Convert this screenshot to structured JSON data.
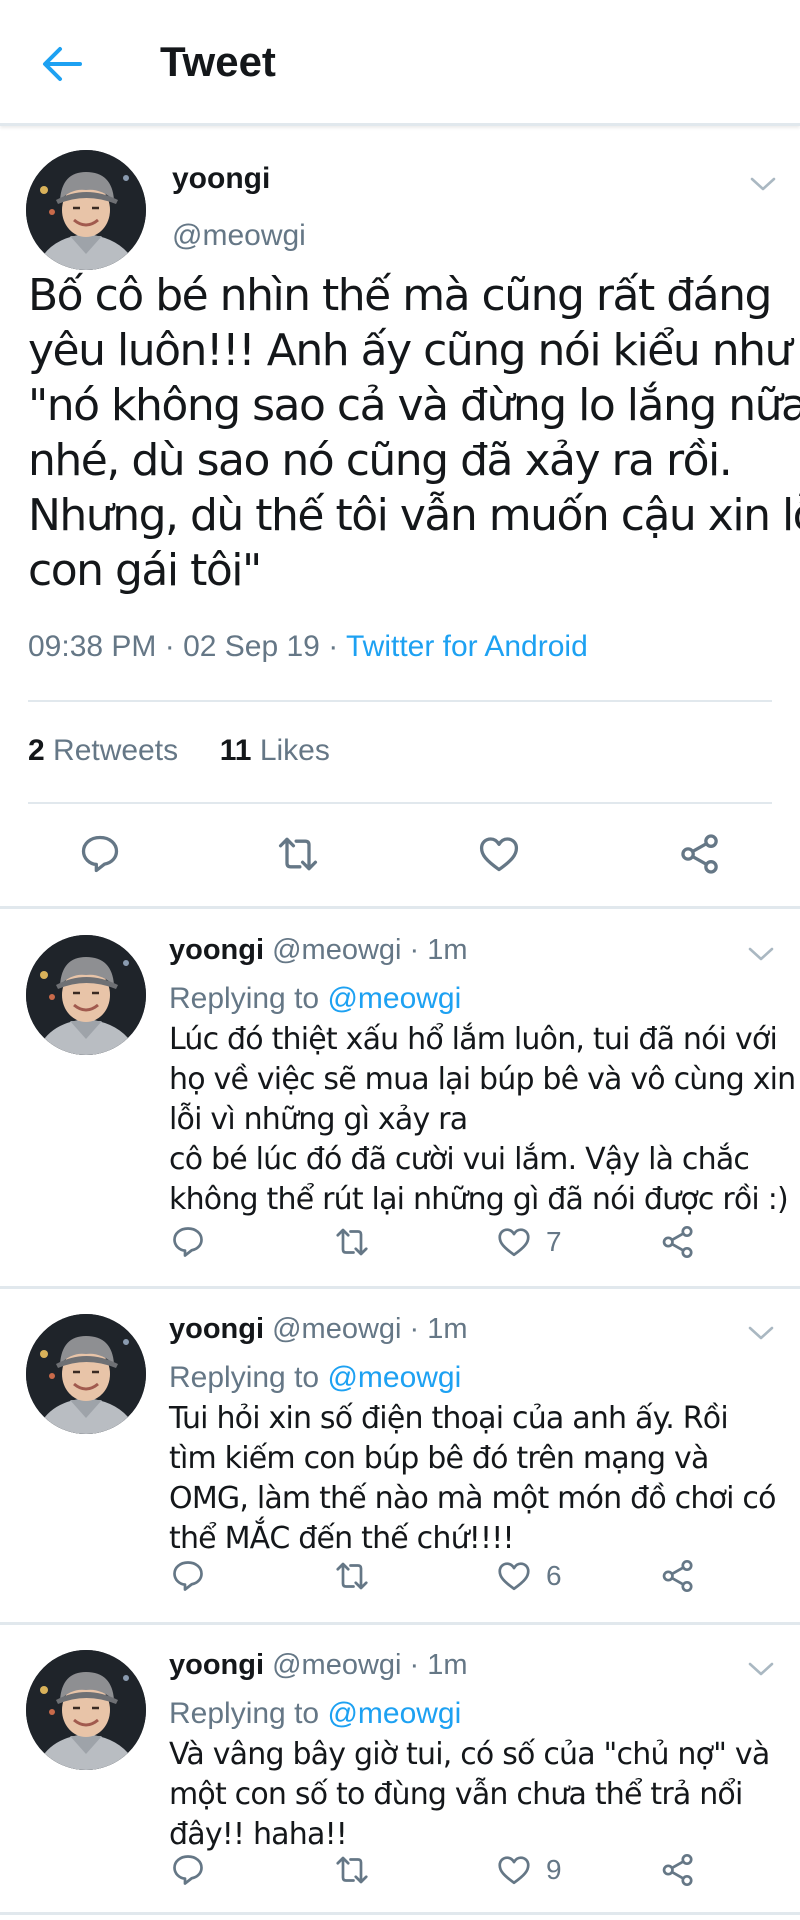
{
  "header": {
    "title": "Tweet"
  },
  "main_tweet": {
    "name": "yoongi",
    "handle": "@meowgi",
    "text_lines": [
      "Bố cô bé nhìn thế mà cũng rất đáng",
      "yêu luôn!!! Anh ấy cũng nói kiểu như",
      "\"nó không sao cả và đừng lo lắng nữa",
      "nhé, dù sao nó cũng đã xảy ra rồi.",
      "Nhưng, dù thế tôi vẫn muốn cậu xin lỗi",
      "con gái tôi\""
    ],
    "time": "09:38 PM · 02 Sep 19 · ",
    "source": "Twitter for Android",
    "retweets_count": "2",
    "retweets_label": " Retweets",
    "likes_count": "11",
    "likes_label": " Likes"
  },
  "replies": [
    {
      "name": "yoongi",
      "handle": "@meowgi · 1m",
      "replying_prefix": "Replying to ",
      "replying_to": "@meowgi",
      "text_lines": [
        "Lúc đó thiệt xấu hổ lắm luôn, tui đã nói với",
        "họ về việc sẽ mua lại búp bê và vô cùng xin",
        "lỗi vì những gì xảy ra",
        "cô bé lúc đó đã cười vui lắm. Vậy là chắc",
        "không thể rút lại những gì đã nói được rồi :)"
      ],
      "likes": "7"
    },
    {
      "name": "yoongi",
      "handle": "@meowgi · 1m",
      "replying_prefix": "Replying to ",
      "replying_to": "@meowgi",
      "text_lines": [
        "Tui hỏi xin số điện thoại của anh ấy. Rồi",
        "tìm kiếm con búp bê đó trên mạng và",
        "OMG, làm thế nào mà một món đồ chơi có",
        "thể MẮC đến thế chứ!!!!"
      ],
      "likes": "6"
    },
    {
      "name": "yoongi",
      "handle": "@meowgi · 1m",
      "replying_prefix": "Replying to ",
      "replying_to": "@meowgi",
      "text_lines": [
        "Và vâng bây giờ tui, có số của \"chủ nợ\" và",
        "một con số to đùng vẫn chưa thể trả nổi",
        "đây!! haha!!"
      ],
      "likes": "9"
    }
  ],
  "colors": {
    "accent": "#1da1f2",
    "secondary_text": "#657786",
    "divider": "#e1e8ed"
  },
  "icons": [
    "back-arrow-icon",
    "chevron-down-icon",
    "reply-icon",
    "retweet-icon",
    "like-icon",
    "share-icon"
  ]
}
